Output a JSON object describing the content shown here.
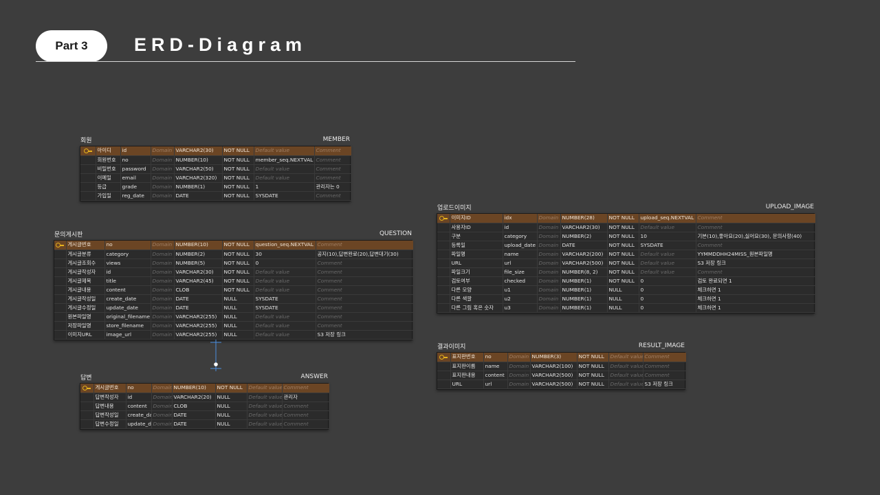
{
  "header": {
    "part_label": "Part 3",
    "title": "ERD-Diagram"
  },
  "placeholders": {
    "domain": "Domain",
    "default": "Default value",
    "comment": "Comment"
  },
  "tables": {
    "member": {
      "label": "회원",
      "name": "MEMBER",
      "rows": [
        [
          "아이디",
          "id",
          "",
          "VARCHAR2(30)",
          "NOT NULL",
          "",
          ""
        ],
        [
          "회원번호",
          "no",
          "",
          "NUMBER(10)",
          "NOT NULL",
          "member_seq.NEXTVAL",
          ""
        ],
        [
          "비밀번호",
          "password",
          "",
          "VARCHAR2(50)",
          "NOT NULL",
          "",
          ""
        ],
        [
          "이메일",
          "email",
          "",
          "VARCHAR2(320)",
          "NOT NULL",
          "",
          ""
        ],
        [
          "등급",
          "grade",
          "",
          "NUMBER(1)",
          "NOT NULL",
          "1",
          "관리자는 0"
        ],
        [
          "가입일",
          "reg_date",
          "",
          "DATE",
          "NOT NULL",
          "SYSDATE",
          ""
        ]
      ]
    },
    "question": {
      "label": "문의게시판",
      "name": "QUESTION",
      "rows": [
        [
          "게시글번호",
          "no",
          "",
          "NUMBER(10)",
          "NOT NULL",
          "question_seq.NEXTVAL",
          ""
        ],
        [
          "게시글분류",
          "category",
          "",
          "NUMBER(2)",
          "NOT NULL",
          "30",
          "공지(10),답변완료(20),답변대기(30)"
        ],
        [
          "게시글조회수",
          "views",
          "",
          "NUMBER(5)",
          "NOT NULL",
          "0",
          ""
        ],
        [
          "게시글작성자",
          "id",
          "",
          "VARCHAR2(30)",
          "NOT NULL",
          "",
          ""
        ],
        [
          "게시글제목",
          "title",
          "",
          "VARCHAR2(45)",
          "NOT NULL",
          "",
          ""
        ],
        [
          "게시글내용",
          "content",
          "",
          "CLOB",
          "NOT NULL",
          "",
          ""
        ],
        [
          "게시글작성일",
          "create_date",
          "",
          "DATE",
          "NULL",
          "SYSDATE",
          ""
        ],
        [
          "게시글수정일",
          "update_date",
          "",
          "DATE",
          "NULL",
          "SYSDATE",
          ""
        ],
        [
          "원본파일명",
          "original_filename",
          "",
          "VARCHAR2(255)",
          "NULL",
          "",
          ""
        ],
        [
          "저장파일명",
          "store_filename",
          "",
          "VARCHAR2(255)",
          "NULL",
          "",
          ""
        ],
        [
          "이미지URL",
          "image_url",
          "",
          "VARCHAR2(255)",
          "NULL",
          "",
          "S3 저장 링크"
        ]
      ]
    },
    "answer": {
      "label": "답변",
      "name": "ANSWER",
      "rows": [
        [
          "게시글번호",
          "no",
          "",
          "NUMBER(10)",
          "NOT NULL",
          "",
          ""
        ],
        [
          "답변작성자",
          "id",
          "",
          "VARCHAR2(20)",
          "NULL",
          "",
          "관리자"
        ],
        [
          "답변내용",
          "content",
          "",
          "CLOB",
          "NULL",
          "",
          ""
        ],
        [
          "답변작성일",
          "create_date",
          "",
          "DATE",
          "NULL",
          "",
          ""
        ],
        [
          "답변수정일",
          "update_date",
          "",
          "DATE",
          "NULL",
          "",
          ""
        ]
      ]
    },
    "upload_image": {
      "label": "업로드이미지",
      "name": "UPLOAD_IMAGE",
      "rows": [
        [
          "이미지ID",
          "idx",
          "",
          "NUMBER(28)",
          "NOT NULL",
          "upload_seq.NEXTVAL",
          ""
        ],
        [
          "사용자ID",
          "id",
          "",
          "VARCHAR2(30)",
          "NOT NULL",
          "",
          ""
        ],
        [
          "구분",
          "category",
          "",
          "NUMBER(2)",
          "NOT NULL",
          "10",
          "기본(10),좋아요(20),싫어요(30), 문의사항(40)"
        ],
        [
          "등록일",
          "upload_date",
          "",
          "DATE",
          "NOT NULL",
          "SYSDATE",
          ""
        ],
        [
          "파일명",
          "name",
          "",
          "VARCHAR2(200)",
          "NOT NULL",
          "",
          "YYMMDDHH24MISS_원본파일명"
        ],
        [
          "URL",
          "url",
          "",
          "VARCHAR2(500)",
          "NOT NULL",
          "",
          "S3 저장 링크"
        ],
        [
          "파일크기",
          "file_size",
          "",
          "NUMBER(8, 2)",
          "NOT NULL",
          "",
          ""
        ],
        [
          "검토여부",
          "checked",
          "",
          "NUMBER(1)",
          "NOT NULL",
          "0",
          "검토 완료되면 1"
        ],
        [
          "다른 모양",
          "u1",
          "",
          "NUMBER(1)",
          "NULL",
          "0",
          "체크하면 1"
        ],
        [
          "다른 색깔",
          "u2",
          "",
          "NUMBER(1)",
          "NULL",
          "0",
          "체크하면 1"
        ],
        [
          "다른 그림 혹은 숫자",
          "u3",
          "",
          "NUMBER(1)",
          "NULL",
          "0",
          "체크하면 1"
        ]
      ]
    },
    "result_image": {
      "label": "결과이미지",
      "name": "RESULT_IMAGE",
      "rows": [
        [
          "표지판번호",
          "no",
          "",
          "NUMBER(3)",
          "NOT NULL",
          "",
          ""
        ],
        [
          "표지판이름",
          "name",
          "",
          "VARCHAR2(100)",
          "NOT NULL",
          "",
          ""
        ],
        [
          "표지판내용",
          "content",
          "",
          "VARCHAR2(500)",
          "NOT NULL",
          "",
          ""
        ],
        [
          "URL",
          "url",
          "",
          "VARCHAR2(500)",
          "NOT NULL",
          "",
          "S3 저장 링크"
        ]
      ]
    }
  },
  "colors": {
    "background": "#3d3d3d",
    "primary_key_row": "#6b4524",
    "key_icon": "#e7b21c",
    "connector": "#4a8fe0"
  }
}
